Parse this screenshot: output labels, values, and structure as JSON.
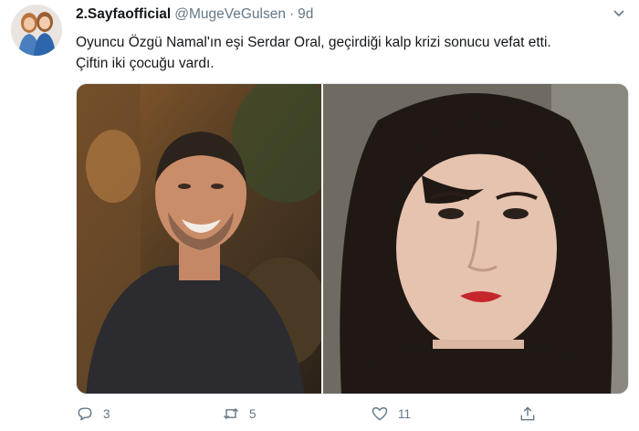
{
  "author": {
    "name": "2.Sayfaofficial",
    "handle": "@MugeVeGulsen",
    "separator": "·",
    "time": "9d"
  },
  "tweet": {
    "lines": [
      "Oyuncu Özgü Namal'ın eşi Serdar Oral, geçirdiği kalp krizi sonucu vefat etti.",
      "Çiftin iki çocuğu vardı."
    ]
  },
  "actions": {
    "reply": {
      "icon": "reply-icon",
      "count": "3"
    },
    "retweet": {
      "icon": "retweet-icon",
      "count": "5"
    },
    "like": {
      "icon": "heart-icon",
      "count": "11"
    },
    "share": {
      "icon": "share-icon"
    }
  },
  "colors": {
    "text": "#14171a",
    "muted": "#657786",
    "border": "#e1e8ed"
  }
}
